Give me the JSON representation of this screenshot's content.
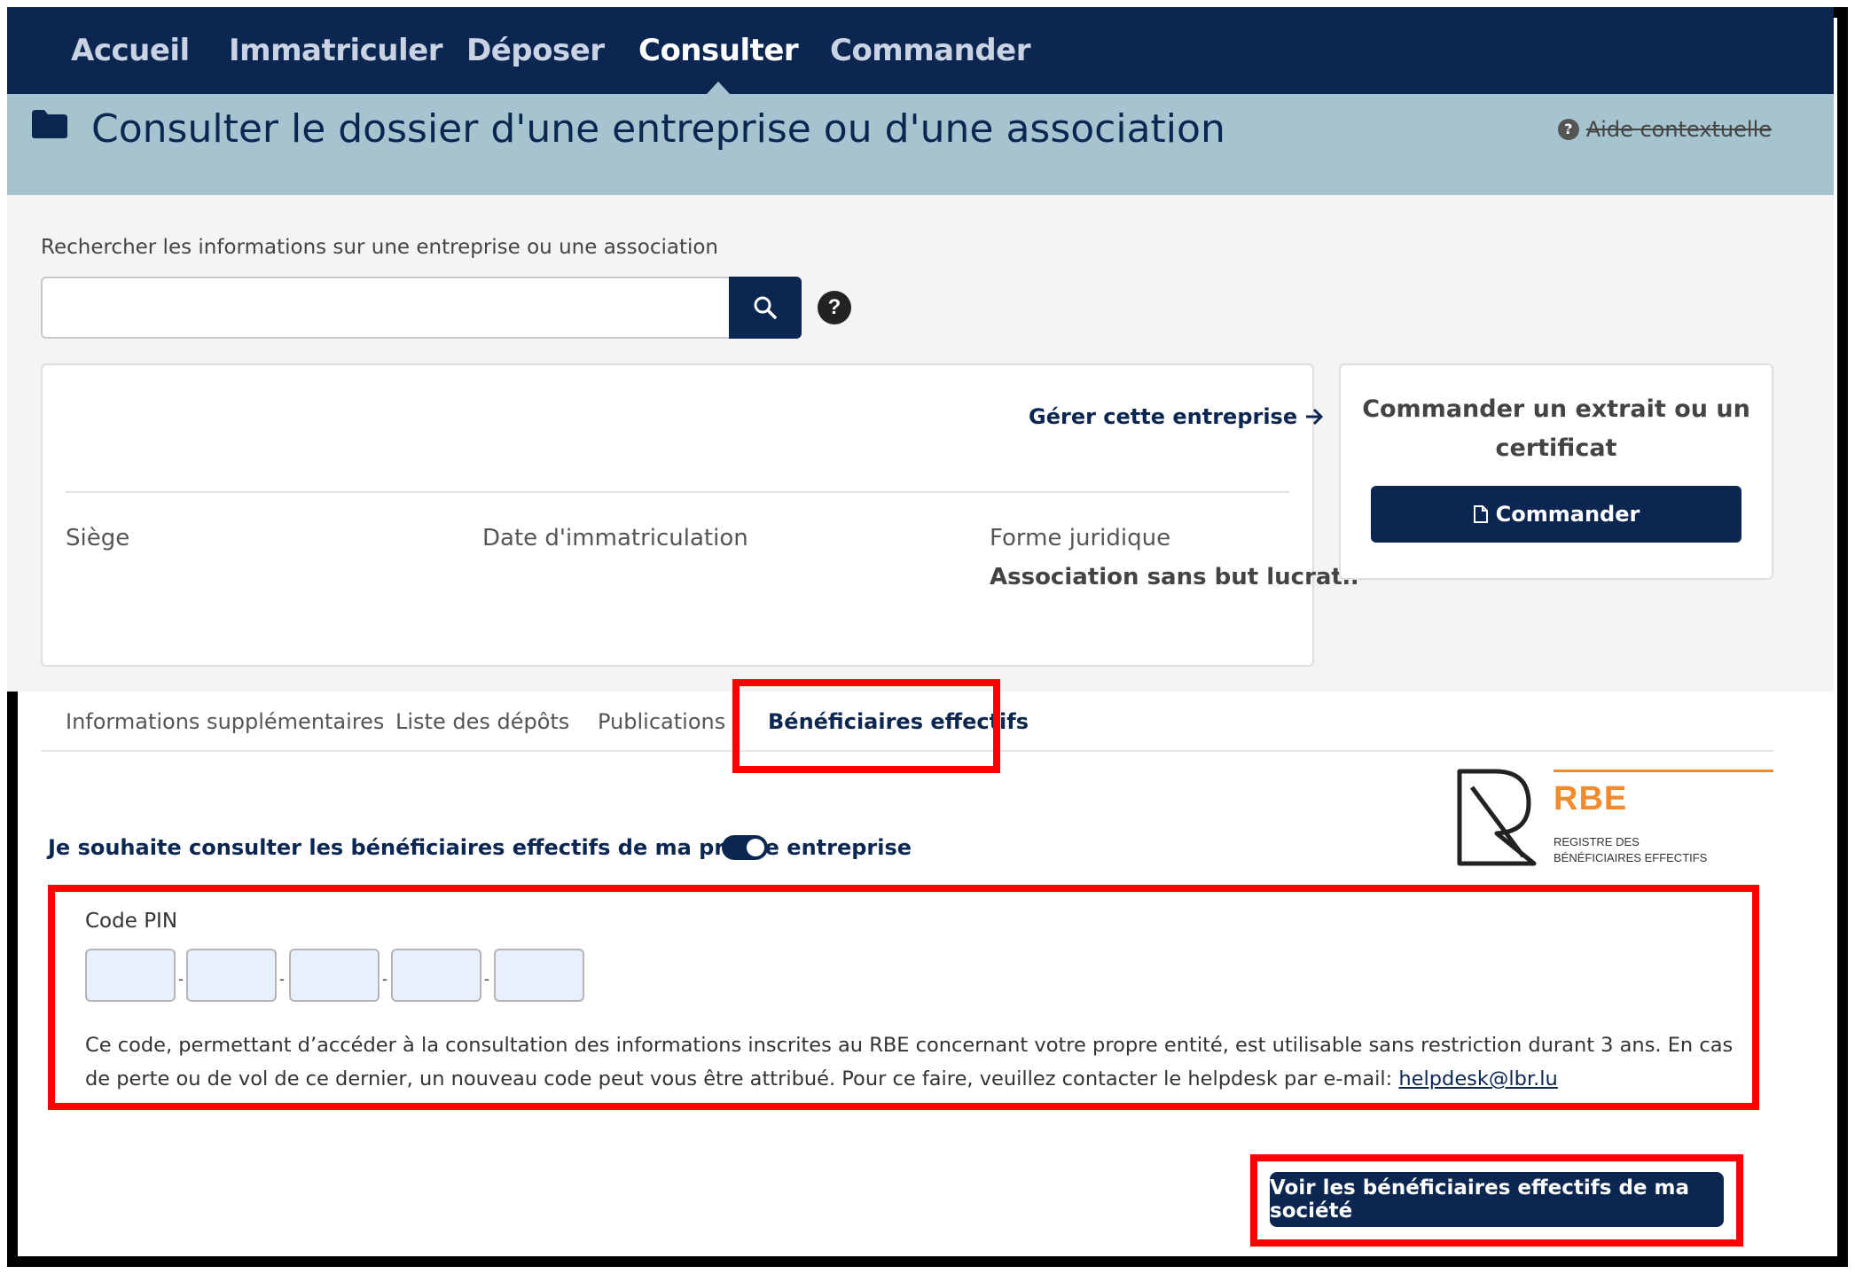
{
  "nav": {
    "items": [
      {
        "label": "Accueil"
      },
      {
        "label": "Immatriculer"
      },
      {
        "label": "Déposer"
      },
      {
        "label": "Consulter",
        "active": true
      },
      {
        "label": "Commander"
      }
    ]
  },
  "header": {
    "title": "Consulter le dossier d'une entreprise ou d'une association",
    "help_link": "Aide contextuelle",
    "folder_icon": "folder-icon"
  },
  "search": {
    "label": "Rechercher les informations sur une entreprise ou une association",
    "value": "",
    "placeholder": "",
    "button_icon": "search-icon",
    "help_icon": "question-icon"
  },
  "company_card": {
    "manage_link": "Gérer cette entreprise",
    "fields": [
      {
        "label": "Siège",
        "value": ""
      },
      {
        "label": "Date d'immatriculation",
        "value": ""
      },
      {
        "label": "Forme juridique",
        "value": "Association sans but lucratif"
      }
    ]
  },
  "order_card": {
    "title": "Commander un extrait ou un certificat",
    "button_label": "Commander"
  },
  "tabs": [
    {
      "label": "Informations supplémentaires"
    },
    {
      "label": "Liste des dépôts"
    },
    {
      "label": "Publications"
    },
    {
      "label": "Bénéficiaires effectifs",
      "active": true
    }
  ],
  "rbe_logo": {
    "acronym": "RBE",
    "line1": "REGISTRE DES",
    "line2": "BÉNÉFICIAIRES EFFECTIFS",
    "accent": "#f28a2e"
  },
  "own_company": {
    "toggle_label": "Je souhaite consulter les bénéficiaires effectifs de ma propre entreprise",
    "toggle_on": true
  },
  "pin": {
    "label": "Code PIN",
    "boxes": [
      "",
      "",
      "",
      "",
      ""
    ],
    "separator": "-",
    "description": "Ce code, permettant d’accéder à la consultation des informations inscrites au RBE concernant votre propre entité, est utilisable sans restriction durant 3 ans. En cas de perte ou de vol de ce dernier, un nouveau code peut vous être attribué. Pour ce faire, veuillez contacter le helpdesk par e-mail: ",
    "email": "helpdesk@lbr.lu"
  },
  "submit": {
    "label": "Voir les bénéficiaires effectifs de ma société"
  },
  "colors": {
    "navy": "#0b2650",
    "band": "#a6c4d0",
    "highlight": "#ff0000"
  }
}
